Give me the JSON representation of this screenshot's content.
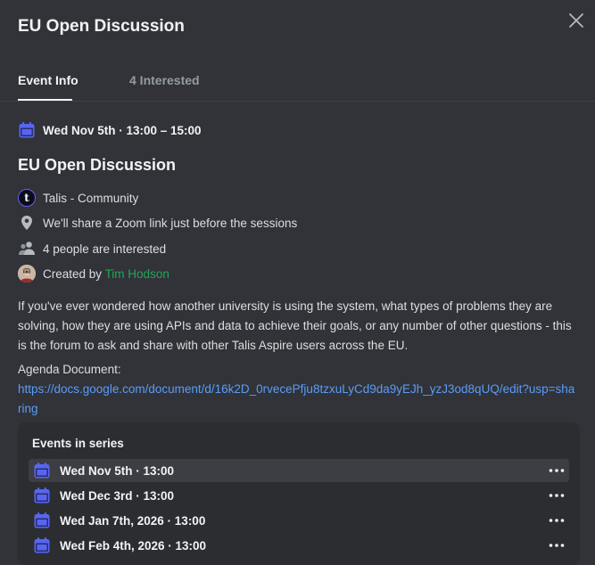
{
  "header": {
    "title": "EU Open Discussion",
    "close_icon": "close-icon"
  },
  "tabs": [
    {
      "label": "Event Info",
      "active": true
    },
    {
      "label": "4 Interested",
      "active": false
    }
  ],
  "event": {
    "date": "Wed Nov 5th · 13:00 – 15:00",
    "name": "EU Open Discussion",
    "community": "Talis - Community",
    "location": "We'll share a Zoom link just before the sessions",
    "interested": "4 people are interested",
    "created_by_prefix": "Created by",
    "creator": "Tim Hodson",
    "description": "If you've ever wondered how another university is using the system, what types of problems they are solving, how they are using APIs and data to achieve their goals, or any number of other questions - this is the forum to ask and share with other Talis Aspire users across the EU.",
    "agenda_label": "Agenda Document:",
    "agenda_link": "https://docs.google.com/document/d/16k2D_0rvecePfju8tzxuLyCd9da9yEJh_yzJ3od8qUQ/edit?usp=sharing"
  },
  "series": {
    "title": "Events in series",
    "items": [
      {
        "label": "Wed Nov 5th · 13:00",
        "active": true
      },
      {
        "label": "Wed Dec 3rd · 13:00",
        "active": false
      },
      {
        "label": "Wed Jan 7th, 2026 · 13:00",
        "active": false
      },
      {
        "label": "Wed Feb 4th, 2026 · 13:00",
        "active": false
      }
    ]
  },
  "colors": {
    "background": "#313338",
    "accent_calendar": "#5865f2",
    "link": "#5a9cf8",
    "creator": "#23a55a"
  },
  "icons": [
    "calendar-icon",
    "location-pin-icon",
    "people-icon",
    "more-options-icon",
    "talis-logo",
    "avatar"
  ]
}
